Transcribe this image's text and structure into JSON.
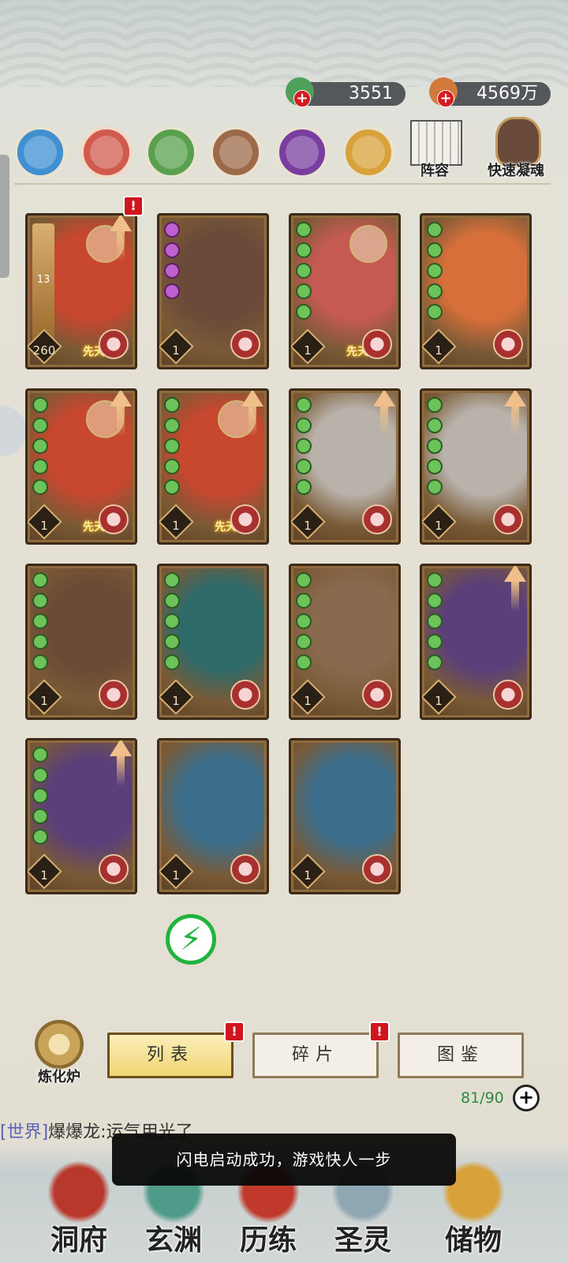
{
  "resources": {
    "jade": {
      "value": "3551",
      "icon": "jade-coin-icon"
    },
    "gold": {
      "value": "4569万",
      "icon": "gold-ingot-icon"
    }
  },
  "elements": [
    {
      "name": "water-element-icon",
      "color": "#3f8fd1"
    },
    {
      "name": "fire-element-icon",
      "color": "#d05a4e"
    },
    {
      "name": "wood-element-icon",
      "color": "#58a04e"
    },
    {
      "name": "earth-element-icon",
      "color": "#9c6a48"
    },
    {
      "name": "dark-element-icon",
      "color": "#7a3ea0"
    },
    {
      "name": "light-element-icon",
      "color": "#d8a13a"
    }
  ],
  "tools": {
    "formation_label": "阵容",
    "quick_condense_label": "快速凝魂"
  },
  "cards": [
    {
      "level": "260",
      "pips": [],
      "lock": true,
      "up": true,
      "badge": "先天",
      "alert": true,
      "art": "#c7472f",
      "star": "13"
    },
    {
      "level": "1",
      "pips": [
        "purple",
        "purple",
        "purple",
        "purple"
      ],
      "lock": false,
      "up": false,
      "badge": "",
      "alert": false,
      "art": "#6b4a3a"
    },
    {
      "level": "1",
      "pips": [
        "green",
        "green",
        "green",
        "green",
        "green"
      ],
      "lock": true,
      "up": false,
      "badge": "先天",
      "alert": false,
      "art": "#c45a52"
    },
    {
      "level": "1",
      "pips": [
        "green",
        "green",
        "green",
        "green",
        "green"
      ],
      "lock": false,
      "up": false,
      "badge": "",
      "alert": false,
      "art": "#d76f3a"
    },
    {
      "level": "1",
      "pips": [
        "green",
        "green",
        "green",
        "green",
        "green"
      ],
      "lock": true,
      "up": true,
      "badge": "先天",
      "alert": false,
      "art": "#c7472f"
    },
    {
      "level": "1",
      "pips": [
        "green",
        "green",
        "green",
        "green",
        "green"
      ],
      "lock": true,
      "up": true,
      "badge": "先天",
      "alert": false,
      "art": "#c7472f"
    },
    {
      "level": "1",
      "pips": [
        "green",
        "green",
        "green",
        "green",
        "green"
      ],
      "lock": false,
      "up": true,
      "badge": "",
      "alert": false,
      "art": "#b8b2aa"
    },
    {
      "level": "1",
      "pips": [
        "green",
        "green",
        "green",
        "green",
        "green"
      ],
      "lock": false,
      "up": true,
      "badge": "",
      "alert": false,
      "art": "#b8b2aa"
    },
    {
      "level": "1",
      "pips": [
        "green",
        "green",
        "green",
        "green",
        "green"
      ],
      "lock": false,
      "up": false,
      "badge": "",
      "alert": false,
      "art": "#6d4a36"
    },
    {
      "level": "1",
      "pips": [
        "green",
        "green",
        "green",
        "green",
        "green"
      ],
      "lock": false,
      "up": false,
      "badge": "",
      "alert": false,
      "art": "#2f6a6a"
    },
    {
      "level": "1",
      "pips": [
        "green",
        "green",
        "green",
        "green",
        "green"
      ],
      "lock": false,
      "up": false,
      "badge": "",
      "alert": false,
      "art": "#8a6a4e"
    },
    {
      "level": "1",
      "pips": [
        "green",
        "green",
        "green",
        "green",
        "green"
      ],
      "lock": false,
      "up": true,
      "badge": "",
      "alert": false,
      "art": "#5a3f7a"
    },
    {
      "level": "1",
      "pips": [
        "green",
        "green",
        "green",
        "green",
        "green"
      ],
      "lock": false,
      "up": true,
      "badge": "",
      "alert": false,
      "art": "#5a3f7a"
    },
    {
      "level": "1",
      "pips": [],
      "lock": false,
      "up": false,
      "badge": "",
      "alert": false,
      "art": "#3d6f8c"
    },
    {
      "level": "1",
      "pips": [],
      "lock": false,
      "up": false,
      "badge": "",
      "alert": false,
      "art": "#3d6f8c"
    }
  ],
  "furnace_label": "炼化炉",
  "tabs": [
    {
      "label": "列表",
      "active": true,
      "alert": false
    },
    {
      "label": "碎片",
      "active": false,
      "alert": true
    },
    {
      "label": "图鉴",
      "active": false,
      "alert": false
    }
  ],
  "capacity": "81/90",
  "chat": {
    "channel": "[世界]",
    "message": "爆爆龙:运气用光了"
  },
  "toast": "闪电启动成功，游戏快人一步",
  "nav": [
    {
      "label": "洞府",
      "icon": "cave-palace-icon",
      "color": "#b8392c"
    },
    {
      "label": "玄渊",
      "icon": "abyss-icon",
      "color": "#4f9b8a"
    },
    {
      "label": "历练",
      "icon": "training-icon",
      "color": "#c0392b"
    },
    {
      "label": "圣灵",
      "icon": "holy-spirit-icon",
      "color": "#8fa6b3"
    },
    {
      "label": "储物",
      "icon": "storage-bag-icon",
      "color": "#d8a13a"
    }
  ]
}
